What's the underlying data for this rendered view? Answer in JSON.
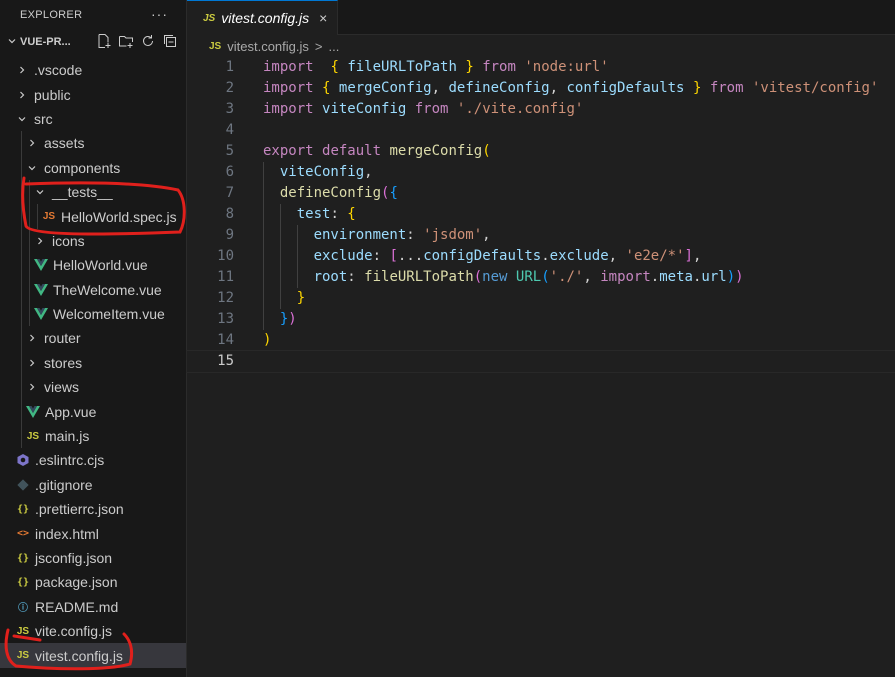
{
  "explorer": {
    "title": "EXPLORER",
    "more": "···",
    "project": "VUE-PR...",
    "tree": [
      {
        "label": ".vscode",
        "depth": 1,
        "kind": "folder",
        "open": false
      },
      {
        "label": "public",
        "depth": 1,
        "kind": "folder",
        "open": false
      },
      {
        "label": "src",
        "depth": 1,
        "kind": "folder",
        "open": true
      },
      {
        "label": "assets",
        "depth": 2,
        "kind": "folder",
        "open": false
      },
      {
        "label": "components",
        "depth": 2,
        "kind": "folder",
        "open": true
      },
      {
        "label": "__tests__",
        "depth": 3,
        "kind": "folder",
        "open": true
      },
      {
        "label": "HelloWorld.spec.js",
        "depth": 4,
        "kind": "js-spec",
        "icon": "JS"
      },
      {
        "label": "icons",
        "depth": 3,
        "kind": "folder",
        "open": false
      },
      {
        "label": "HelloWorld.vue",
        "depth": 3,
        "kind": "vue"
      },
      {
        "label": "TheWelcome.vue",
        "depth": 3,
        "kind": "vue"
      },
      {
        "label": "WelcomeItem.vue",
        "depth": 3,
        "kind": "vue"
      },
      {
        "label": "router",
        "depth": 2,
        "kind": "folder",
        "open": false
      },
      {
        "label": "stores",
        "depth": 2,
        "kind": "folder",
        "open": false
      },
      {
        "label": "views",
        "depth": 2,
        "kind": "folder",
        "open": false
      },
      {
        "label": "App.vue",
        "depth": 2,
        "kind": "vue"
      },
      {
        "label": "main.js",
        "depth": 2,
        "kind": "js",
        "icon": "JS"
      },
      {
        "label": ".eslintrc.cjs",
        "depth": 1,
        "kind": "eslint"
      },
      {
        "label": ".gitignore",
        "depth": 1,
        "kind": "git"
      },
      {
        "label": ".prettierrc.json",
        "depth": 1,
        "kind": "json",
        "icon": "{}"
      },
      {
        "label": "index.html",
        "depth": 1,
        "kind": "html",
        "icon": "<>"
      },
      {
        "label": "jsconfig.json",
        "depth": 1,
        "kind": "json",
        "icon": "{}"
      },
      {
        "label": "package.json",
        "depth": 1,
        "kind": "json",
        "icon": "{}"
      },
      {
        "label": "README.md",
        "depth": 1,
        "kind": "info",
        "icon": "ⓘ"
      },
      {
        "label": "vite.config.js",
        "depth": 1,
        "kind": "js",
        "icon": "JS"
      },
      {
        "label": "vitest.config.js",
        "depth": 1,
        "kind": "js",
        "icon": "JS",
        "selected": true
      }
    ]
  },
  "editor": {
    "tab": {
      "icon": "JS",
      "label": "vitest.config.js",
      "close": "×"
    },
    "breadcrumb": {
      "icon": "JS",
      "file": "vitest.config.js",
      "sep": ">",
      "rest": "..."
    },
    "active_line": 15,
    "lines": [
      [
        [
          "kw",
          "import"
        ],
        [
          "",
          "  "
        ],
        [
          "br1",
          "{"
        ],
        [
          "",
          " "
        ],
        [
          "var",
          "fileURLToPath"
        ],
        [
          "",
          " "
        ],
        [
          "br1",
          "}"
        ],
        [
          "",
          " "
        ],
        [
          "kw",
          "from"
        ],
        [
          "",
          " "
        ],
        [
          "str",
          "'node:url'"
        ]
      ],
      [
        [
          "kw",
          "import"
        ],
        [
          "",
          " "
        ],
        [
          "br1",
          "{"
        ],
        [
          "",
          " "
        ],
        [
          "var",
          "mergeConfig"
        ],
        [
          "",
          ", "
        ],
        [
          "var",
          "defineConfig"
        ],
        [
          "",
          ", "
        ],
        [
          "var",
          "configDefaults"
        ],
        [
          "",
          " "
        ],
        [
          "br1",
          "}"
        ],
        [
          "",
          " "
        ],
        [
          "kw",
          "from"
        ],
        [
          "",
          " "
        ],
        [
          "str",
          "'vitest/config'"
        ]
      ],
      [
        [
          "kw",
          "import"
        ],
        [
          "",
          " "
        ],
        [
          "var",
          "viteConfig"
        ],
        [
          "",
          " "
        ],
        [
          "kw",
          "from"
        ],
        [
          "",
          " "
        ],
        [
          "str",
          "'./vite.config'"
        ]
      ],
      [],
      [
        [
          "kw",
          "export"
        ],
        [
          "",
          " "
        ],
        [
          "kw",
          "default"
        ],
        [
          "",
          " "
        ],
        [
          "fn",
          "mergeConfig"
        ],
        [
          "br1",
          "("
        ]
      ],
      [
        [
          "",
          "  "
        ],
        [
          "var",
          "viteConfig"
        ],
        [
          "",
          ","
        ]
      ],
      [
        [
          "",
          "  "
        ],
        [
          "fn",
          "defineConfig"
        ],
        [
          "br2",
          "("
        ],
        [
          "br3",
          "{"
        ]
      ],
      [
        [
          "",
          "    "
        ],
        [
          "var",
          "test"
        ],
        [
          "",
          ": "
        ],
        [
          "br1",
          "{"
        ]
      ],
      [
        [
          "",
          "      "
        ],
        [
          "var",
          "environment"
        ],
        [
          "",
          ": "
        ],
        [
          "str",
          "'jsdom'"
        ],
        [
          "",
          ","
        ]
      ],
      [
        [
          "",
          "      "
        ],
        [
          "var",
          "exclude"
        ],
        [
          "",
          ": "
        ],
        [
          "br2",
          "["
        ],
        [
          "",
          "..."
        ],
        [
          "var",
          "configDefaults"
        ],
        [
          "",
          "."
        ],
        [
          "var",
          "exclude"
        ],
        [
          "",
          ", "
        ],
        [
          "str",
          "'e2e/*'"
        ],
        [
          "br2",
          "]"
        ],
        [
          "",
          ","
        ]
      ],
      [
        [
          "",
          "      "
        ],
        [
          "var",
          "root"
        ],
        [
          "",
          ": "
        ],
        [
          "fn",
          "fileURLToPath"
        ],
        [
          "br2",
          "("
        ],
        [
          "kw2",
          "new"
        ],
        [
          "",
          " "
        ],
        [
          "cls",
          "URL"
        ],
        [
          "br3",
          "("
        ],
        [
          "str",
          "'./'"
        ],
        [
          "",
          ", "
        ],
        [
          "kw",
          "import"
        ],
        [
          "",
          "."
        ],
        [
          "var",
          "meta"
        ],
        [
          "",
          "."
        ],
        [
          "var",
          "url"
        ],
        [
          "br3",
          ")"
        ],
        [
          "br2",
          ")"
        ]
      ],
      [
        [
          "",
          "    "
        ],
        [
          "br1",
          "}"
        ]
      ],
      [
        [
          "",
          "  "
        ],
        [
          "br3",
          "}"
        ],
        [
          "br2",
          ")"
        ]
      ],
      [
        [
          "br1",
          ")"
        ]
      ],
      []
    ]
  }
}
